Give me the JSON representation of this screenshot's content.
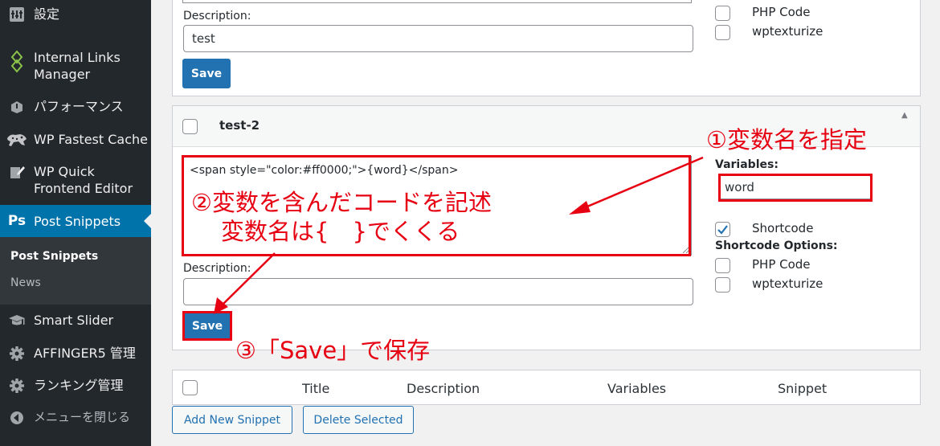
{
  "sidebar": {
    "items": [
      {
        "label": "設定",
        "icon": "settings-icon"
      },
      {
        "label": "Internal Links",
        "label2": "Manager",
        "icon": "internal-links-icon"
      },
      {
        "label": "パフォーマンス",
        "icon": "performance-icon"
      },
      {
        "label": "WP Fastest Cache",
        "icon": "cheetah-icon"
      },
      {
        "label": "WP Quick",
        "label2": "Frontend Editor",
        "icon": "edit-icon"
      },
      {
        "label": "Post Snippets",
        "icon": "ps-logo-icon",
        "icon_text": "Ps"
      },
      {
        "label": "Smart Slider",
        "icon": "graduation-cap-icon"
      },
      {
        "label": "AFFINGER5 管理",
        "icon": "gear-icon"
      },
      {
        "label": "ランキング管理",
        "icon": "gear-icon"
      },
      {
        "label": "メニューを閉じる",
        "icon": "collapse-icon"
      }
    ],
    "submenu": [
      "Post Snippets",
      "News"
    ]
  },
  "snippet1": {
    "description_label": "Description:",
    "description_value": "test",
    "save_label": "Save",
    "options": [
      "PHP Code",
      "wptexturize"
    ]
  },
  "snippet2": {
    "title": "test-2",
    "code": "<span style=\"color:#ff0000;\">{word}</span>",
    "description_label": "Description:",
    "description_value": "",
    "save_label": "Save",
    "variables_label": "Variables:",
    "variables_value": "word",
    "shortcode_label": "Shortcode",
    "shortcode_checked": true,
    "shortcode_options_label": "Shortcode Options:",
    "options": [
      "PHP Code",
      "wptexturize"
    ]
  },
  "table": {
    "columns": [
      "Title",
      "Description",
      "Variables",
      "Snippet"
    ]
  },
  "buttons": {
    "add_new": "Add New Snippet",
    "delete_selected": "Delete Selected"
  },
  "annotations": {
    "step1": "①変数名を指定",
    "step2_line1": "②変数を含んだコードを記述",
    "step2_line2": "変数名は{　}でくくる",
    "step3": "③「Save」で保存"
  },
  "colors": {
    "sidebar_bg": "#23282d",
    "active": "#0073aa",
    "button": "#2271b1",
    "annotation": "#e60012"
  }
}
